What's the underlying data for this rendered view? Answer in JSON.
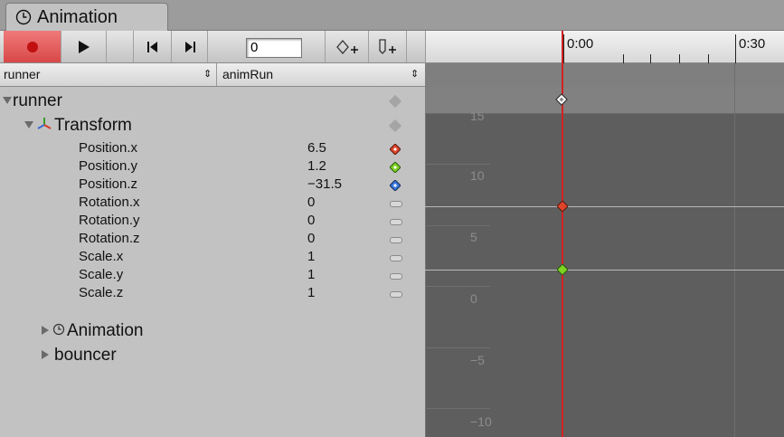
{
  "window": {
    "tab_title": "Animation"
  },
  "toolbar": {
    "frame_value": "0",
    "record_active": true
  },
  "timeline": {
    "labels": [
      "0:00",
      "0:30"
    ]
  },
  "selectors": {
    "object": "runner",
    "clip": "animRun"
  },
  "hierarchy": {
    "root": "runner",
    "transform": "Transform",
    "properties": [
      {
        "name": "Position.x",
        "value": "6.5",
        "key": "red"
      },
      {
        "name": "Position.y",
        "value": "1.2",
        "key": "green"
      },
      {
        "name": "Position.z",
        "value": "−31.5",
        "key": "blue"
      },
      {
        "name": "Rotation.x",
        "value": "0",
        "key": "none"
      },
      {
        "name": "Rotation.y",
        "value": "0",
        "key": "none"
      },
      {
        "name": "Rotation.z",
        "value": "0",
        "key": "none"
      },
      {
        "name": "Scale.x",
        "value": "1",
        "key": "none"
      },
      {
        "name": "Scale.y",
        "value": "1",
        "key": "none"
      },
      {
        "name": "Scale.z",
        "value": "1",
        "key": "none"
      }
    ],
    "animation": "Animation",
    "bouncer": "bouncer"
  },
  "curve_axis": {
    "labels": [
      "15",
      "10",
      "5",
      "0",
      "−5",
      "−10"
    ]
  },
  "colors": {
    "record": "#d94848",
    "playhead": "#d42020",
    "key_red": "#e0452a",
    "key_green": "#7ed321",
    "key_blue": "#3a78e0"
  }
}
